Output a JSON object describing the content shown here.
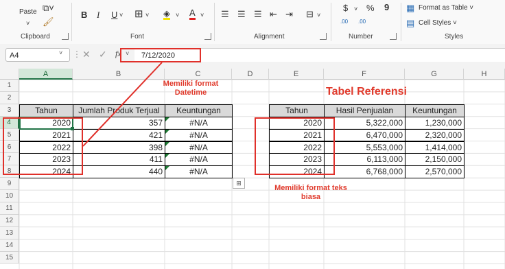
{
  "ribbon": {
    "clipboard": {
      "paste_label": "Paste",
      "group_label": "Clipboard"
    },
    "font": {
      "group_label": "Font",
      "bold": "B",
      "italic": "I",
      "underline": "U",
      "font_color_glyph": "A"
    },
    "alignment": {
      "group_label": "Alignment"
    },
    "number": {
      "group_label": "Number",
      "currency": "$",
      "percent": "%",
      "comma": "9",
      "inc_decimal": ".00",
      "dec_decimal": ".00"
    },
    "styles": {
      "group_label": "Styles",
      "format_as_table": "Format as Table",
      "cell_styles": "Cell Styles"
    }
  },
  "formula_bar": {
    "name_box": "A4",
    "fx": "fx",
    "value": "7/12/2020"
  },
  "sheet": {
    "columns": [
      "A",
      "B",
      "C",
      "D",
      "E",
      "F",
      "G",
      "H"
    ],
    "rows": [
      "1",
      "2",
      "3",
      "4",
      "5",
      "6",
      "7",
      "8",
      "9",
      "10",
      "11",
      "12",
      "13",
      "14",
      "15"
    ],
    "left_table": {
      "headers": [
        "Tahun",
        "Jumlah Produk Terjual",
        "Keuntungan"
      ],
      "rows": [
        [
          "2020",
          "357",
          "#N/A"
        ],
        [
          "2021",
          "421",
          "#N/A"
        ],
        [
          "2022",
          "398",
          "#N/A"
        ],
        [
          "2023",
          "411",
          "#N/A"
        ],
        [
          "2024",
          "440",
          "#N/A"
        ]
      ]
    },
    "right_table": {
      "title": "Tabel Referensi",
      "headers": [
        "Tahun",
        "Hasil Penjualan",
        "Keuntungan"
      ],
      "rows": [
        [
          "2020",
          "5,322,000",
          "1,230,000"
        ],
        [
          "2021",
          "6,470,000",
          "2,320,000"
        ],
        [
          "2022",
          "5,553,000",
          "1,414,000"
        ],
        [
          "2023",
          "6,113,000",
          "2,150,000"
        ],
        [
          "2024",
          "6,768,000",
          "2,570,000"
        ]
      ]
    }
  },
  "annotations": {
    "datetime_line1": "Memiliki format",
    "datetime_line2": "Datetime",
    "text_line1": "Memiliki format teks",
    "text_line2": "biasa"
  },
  "colors": {
    "annotation_red": "#e03a2c",
    "excel_green": "#217346",
    "header_fill": "#d9d9d9"
  }
}
